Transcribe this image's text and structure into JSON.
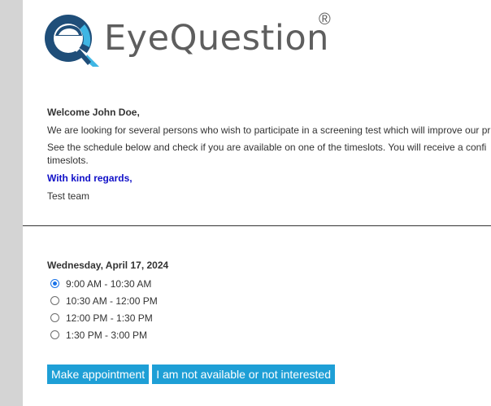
{
  "branding": {
    "name": "EyeQuestion",
    "registered_mark": "®",
    "colors": {
      "logo_dark": "#1f4e79",
      "logo_light": "#3fb6e4",
      "text": "#5e5e5e"
    }
  },
  "message": {
    "greeting": "Welcome John Doe,",
    "line1": "We are looking for several persons who wish to participate in a screening test which will improve our pr",
    "line2a": "See the schedule below and check if you are available on one of the timeslots. You will receive a confi",
    "line2b": "timeslots.",
    "regards": "With kind regards,",
    "signature": "Test team"
  },
  "schedule": {
    "date": "Wednesday, April 17, 2024",
    "slots": [
      {
        "label": "9:00 AM - 10:30 AM",
        "selected": true
      },
      {
        "label": "10:30 AM - 12:00 PM",
        "selected": false
      },
      {
        "label": "12:00 PM - 1:30 PM",
        "selected": false
      },
      {
        "label": "1:30 PM - 3:00 PM",
        "selected": false
      }
    ]
  },
  "actions": {
    "make_appointment": "Make appointment",
    "not_available": "I am not available or not interested"
  }
}
